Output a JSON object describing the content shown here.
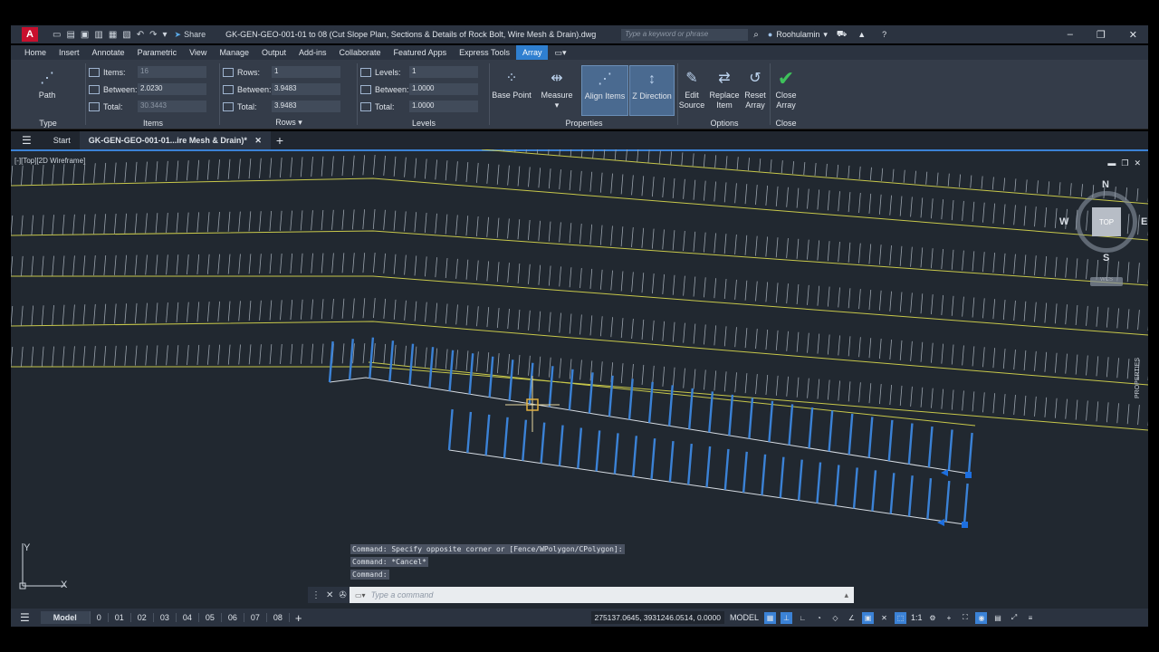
{
  "titlebar": {
    "app_logo": "A",
    "share_label": "Share",
    "doc_title": "GK-GEN-GEO-001-01 to 08 (Cut Slope Plan, Sections & Details of Rock Bolt, Wire Mesh & Drain).dwg",
    "search_placeholder": "Type a keyword or phrase",
    "user_name": "Roohulamin"
  },
  "ribbon_tabs": [
    "Home",
    "Insert",
    "Annotate",
    "Parametric",
    "View",
    "Manage",
    "Output",
    "Add-ins",
    "Collaborate",
    "Featured Apps",
    "Express Tools",
    "Array"
  ],
  "active_ribbon_tab": "Array",
  "ribbon": {
    "type": {
      "button": "Path",
      "title": "Type"
    },
    "items": {
      "title": "Items",
      "items_label": "Items:",
      "items_value": "16",
      "between_label": "Between:",
      "between_value": "2.0230",
      "total_label": "Total:",
      "total_value": "30.3443"
    },
    "rows": {
      "title": "Rows",
      "rows_label": "Rows:",
      "rows_value": "1",
      "between_label": "Between:",
      "between_value": "3.9483",
      "total_label": "Total:",
      "total_value": "3.9483"
    },
    "levels": {
      "title": "Levels",
      "levels_label": "Levels:",
      "levels_value": "1",
      "between_label": "Between:",
      "between_value": "1.0000",
      "total_label": "Total:",
      "total_value": "1.0000"
    },
    "properties": {
      "title": "Properties",
      "base_point": "Base Point",
      "measure": "Measure",
      "align_items": "Align Items",
      "z_direction": "Z Direction"
    },
    "options": {
      "title": "Options",
      "edit_source_1": "Edit",
      "edit_source_2": "Source",
      "replace_item_1": "Replace",
      "replace_item_2": "Item",
      "reset_array_1": "Reset",
      "reset_array_2": "Array"
    },
    "close": {
      "title": "Close",
      "close_1": "Close",
      "close_2": "Array"
    }
  },
  "file_tabs": {
    "start": "Start",
    "active": "GK-GEN-GEO-001-01...ire Mesh & Drain)*"
  },
  "viewport": {
    "label": "[-][Top][2D Wireframe]",
    "viewcube": {
      "n": "N",
      "s": "S",
      "e": "E",
      "w": "W",
      "top": "TOP",
      "wcs": "WCS"
    },
    "ucs_x": "X",
    "ucs_y": "Y",
    "properties_tab": "PROPERTIES"
  },
  "command": {
    "history": [
      "Command: Specify opposite corner or [Fence/WPolygon/CPolygon]:",
      "Command: *Cancel*",
      "Command:"
    ],
    "input_placeholder": "Type a command"
  },
  "statusbar": {
    "layout_tabs": [
      "Model",
      "0",
      "01",
      "02",
      "03",
      "04",
      "05",
      "06",
      "07",
      "08"
    ],
    "coords": "275137.0645, 3931246.0514, 0.0000",
    "model": "MODEL",
    "scale": "1:1"
  },
  "colors": {
    "accent": "#2f7fd0",
    "drawing_bg": "#212830",
    "slope_line": "#c8c84a",
    "selected": "#3b82d6"
  }
}
